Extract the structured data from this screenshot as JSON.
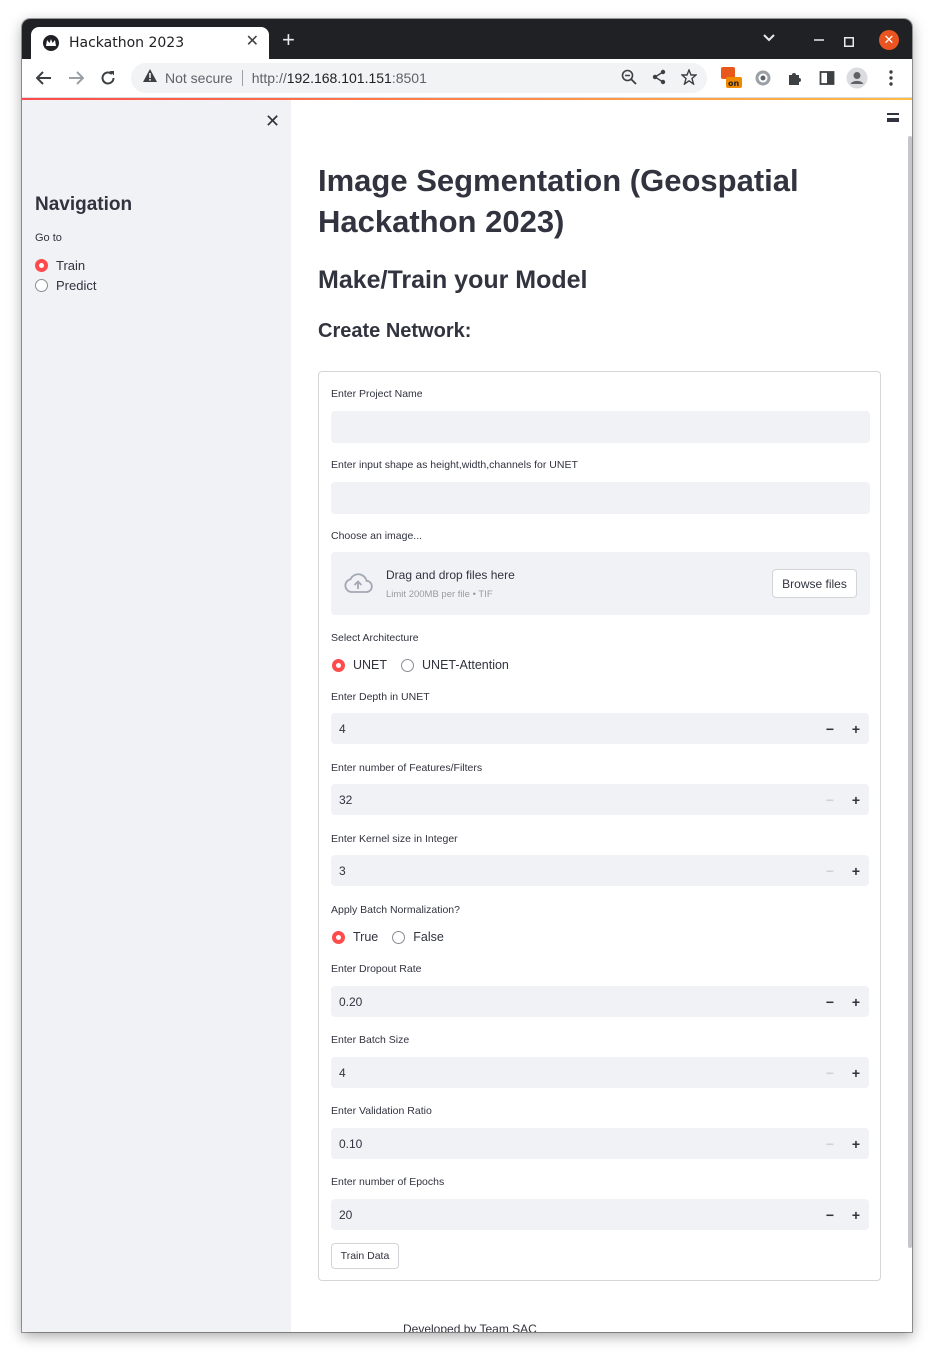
{
  "browser": {
    "tab_title": "Hackathon 2023",
    "security_label": "Not secure",
    "url_scheme": "http://",
    "url_host": "192.168.101.151",
    "url_port": ":8501",
    "extension_badge": "on"
  },
  "sidebar": {
    "title": "Navigation",
    "goto_label": "Go to",
    "options": [
      {
        "label": "Train",
        "selected": true
      },
      {
        "label": "Predict",
        "selected": false
      }
    ]
  },
  "main": {
    "title": "Image Segmentation (Geospatial Hackathon 2023)",
    "subtitle": "Make/Train your Model",
    "section": "Create Network:",
    "footer": "Developed by Team SAC"
  },
  "form": {
    "project_name_label": "Enter Project Name",
    "project_name_value": "",
    "input_shape_label": "Enter input shape as height,width,channels for UNET",
    "input_shape_value": "",
    "image_label": "Choose an image...",
    "uploader_title": "Drag and drop files here",
    "uploader_limit": "Limit 200MB per file • TIF",
    "browse_label": "Browse files",
    "architecture_label": "Select Architecture",
    "architecture_options": [
      {
        "label": "UNET",
        "selected": true
      },
      {
        "label": "UNET-Attention",
        "selected": false
      }
    ],
    "depth_label": "Enter Depth in UNET",
    "depth_value": "4",
    "features_label": "Enter number of Features/Filters",
    "features_value": "32",
    "kernel_label": "Enter Kernel size in Integer",
    "kernel_value": "3",
    "batchnorm_label": "Apply Batch Normalization?",
    "batchnorm_options": [
      {
        "label": "True",
        "selected": true
      },
      {
        "label": "False",
        "selected": false
      }
    ],
    "dropout_label": "Enter Dropout Rate",
    "dropout_value": "0.20",
    "batch_size_label": "Enter Batch Size",
    "batch_size_value": "4",
    "validation_label": "Enter Validation Ratio",
    "validation_value": "0.10",
    "epochs_label": "Enter number of Epochs",
    "epochs_value": "20",
    "train_button": "Train Data",
    "stepper_minus": "−",
    "stepper_plus": "+"
  },
  "colors": {
    "accent": "#ff4b4b",
    "sidebar_bg": "#f0f2f6",
    "text": "#31333f",
    "titlebar": "#202124"
  }
}
